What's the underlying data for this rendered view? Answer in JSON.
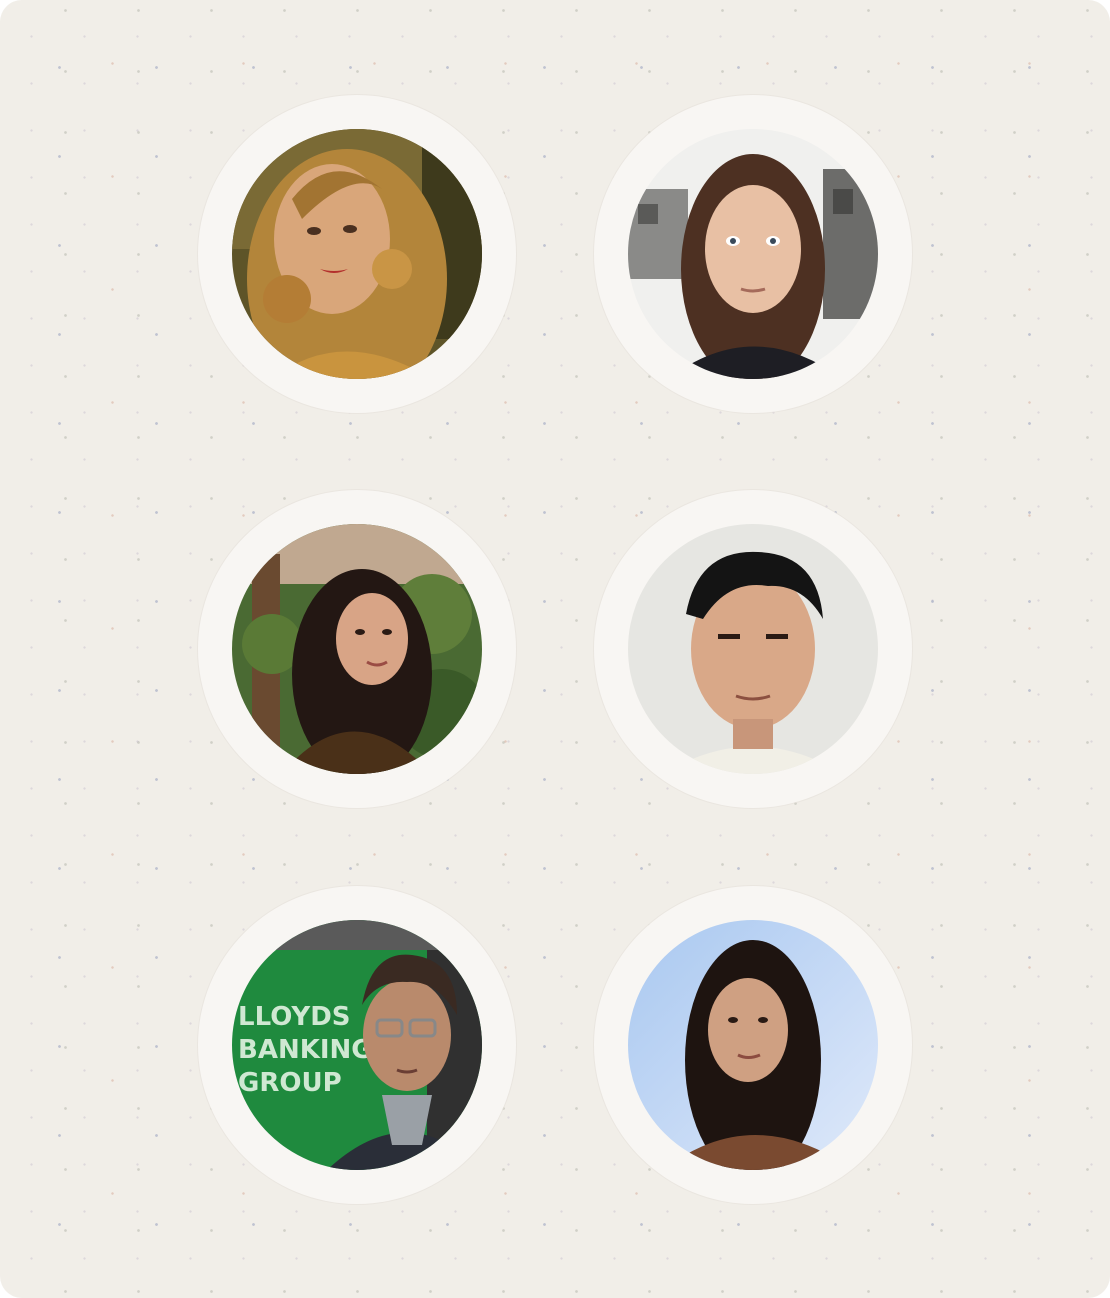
{
  "avatars": [
    {
      "id": "avatar-1",
      "background": "#6b5a2e",
      "hair": "#b98a3a"
    },
    {
      "id": "avatar-2",
      "background": "#ededed",
      "hair": "#4a2f22"
    },
    {
      "id": "avatar-3",
      "background": "#3f5a2c",
      "hair": "#241814"
    },
    {
      "id": "avatar-4",
      "background": "#e4e4e0",
      "hair": "#121212"
    },
    {
      "id": "avatar-5",
      "background": "#1f8a3e",
      "hair": "#3a2a22"
    },
    {
      "id": "avatar-6",
      "background": "#bcd4f4",
      "hair": "#1e1410"
    }
  ],
  "sign": {
    "line1": "LLOYDS",
    "line2": "BANKING",
    "line3": "GROUP"
  }
}
